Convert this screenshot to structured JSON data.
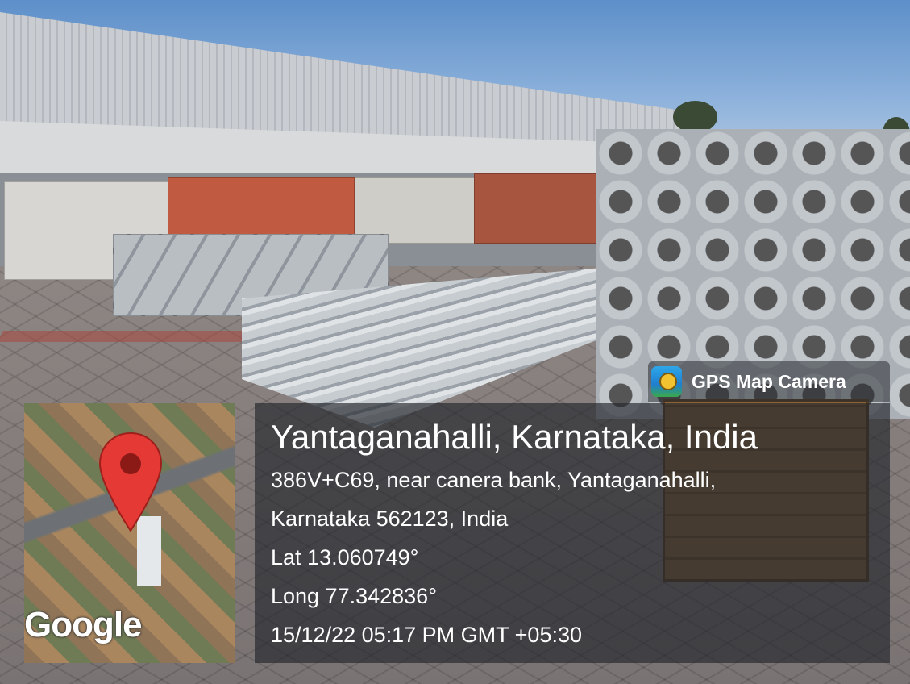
{
  "overlay": {
    "app_badge": {
      "label": "GPS Map Camera",
      "icon": "gps-map-camera-app-icon"
    },
    "map_thumbnail": {
      "logo": "Google",
      "marker_icon": "map-pin-icon"
    },
    "location": {
      "title": "Yantaganahalli, Karnataka, India",
      "address_line1": "386V+C69, near canera bank, Yantaganahalli,",
      "address_line2": "Karnataka 562123, India",
      "latitude": "Lat 13.060749°",
      "longitude": "Long 77.342836°",
      "timestamp": "15/12/22 05:17 PM GMT +05:30"
    }
  },
  "colors": {
    "pin": "#e53935",
    "panel": "#23262c"
  }
}
